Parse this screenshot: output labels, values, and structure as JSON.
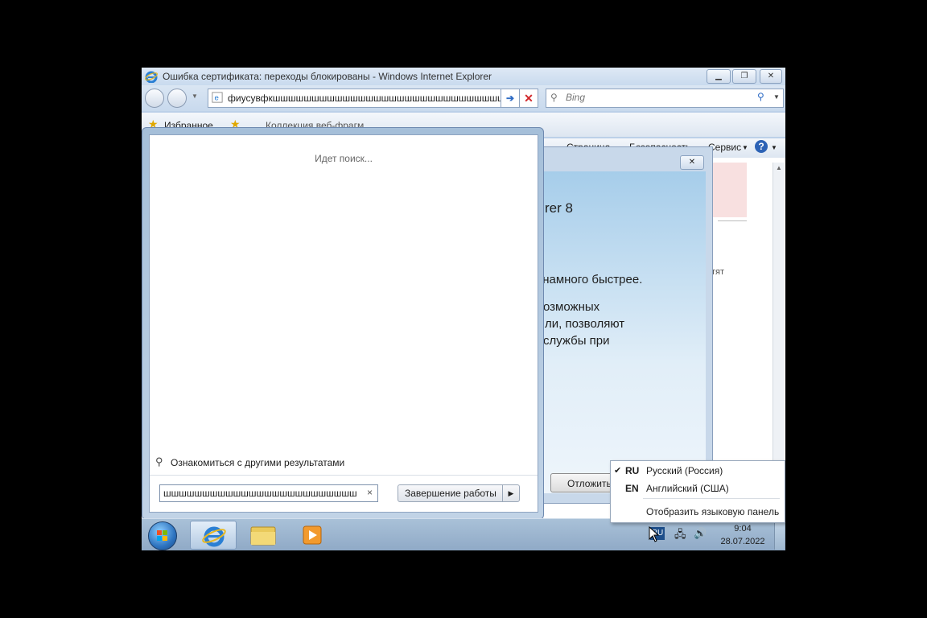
{
  "ie": {
    "title": "Ошибка сертификата: переходы блокированы - Windows Internet Explorer",
    "address": "фиусувфкшшшшшшшшшшшшшшшшшшшшшшшшшшшшшшшшшшшшшшшшшшшш",
    "search_placeholder": "Bing",
    "favorites_label": "Избранное",
    "webslices_label": "Коллекция веб-фрагм...",
    "cmd_page": "Страница",
    "cmd_safety": "Безопасность",
    "cmd_tools": "Сервис"
  },
  "dialog": {
    "line1": "rer 8",
    "line2": "те намного быстрее.",
    "line3": "озможных",
    "line4": "ли, позволяют",
    "line5": "службы при",
    "defer_label": "Отложить",
    "side_text": "тят"
  },
  "start_menu": {
    "searching_text": "Идет поиск...",
    "more_results_label": "Ознакомиться с другими результатами",
    "search_value": "шшшшшшшшшшшшшшшшшшшшшшшшшш",
    "clear_label": "×",
    "shutdown_label": "Завершение работы"
  },
  "taskbar": {
    "time": "9:04",
    "date": "28.07.2022",
    "lang_indicator": "RU"
  },
  "lang_popup": {
    "items": [
      {
        "code": "RU",
        "name": "Русский (Россия)",
        "checked": "✔"
      },
      {
        "code": "EN",
        "name": "Английский (США)",
        "checked": ""
      }
    ],
    "show_bar_label": "Отобразить языковую панель"
  }
}
